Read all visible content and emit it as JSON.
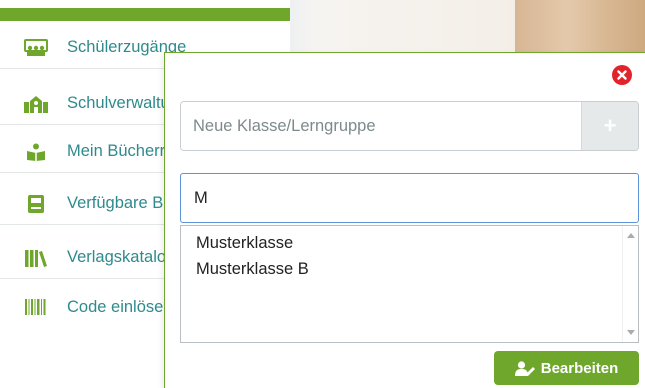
{
  "sidebar": {
    "items": [
      {
        "label": "Schülerzugänge",
        "icon": "students-access-icon"
      },
      {
        "label": "Schulverwaltung",
        "icon": "school-admin-icon"
      },
      {
        "label": "Mein Bücherregal",
        "icon": "bookshelf-icon"
      },
      {
        "label": "Verfügbare Bücher",
        "icon": "available-books-icon"
      },
      {
        "label": "Verlagskatalog",
        "icon": "publisher-catalog-icon"
      },
      {
        "label": "Code einlösen",
        "icon": "barcode-icon"
      }
    ]
  },
  "modal": {
    "new_class_placeholder": "Neue Klasse/Lerngruppe",
    "add_label": "+",
    "filter_value": "M",
    "options": [
      "Musterklasse",
      "Musterklasse B"
    ],
    "edit_label": "Bearbeiten"
  },
  "colors": {
    "brand_green": "#6ea72c",
    "link_teal": "#2f8a8d",
    "close_red": "#e3232b",
    "focus_blue": "#5d93d8"
  }
}
